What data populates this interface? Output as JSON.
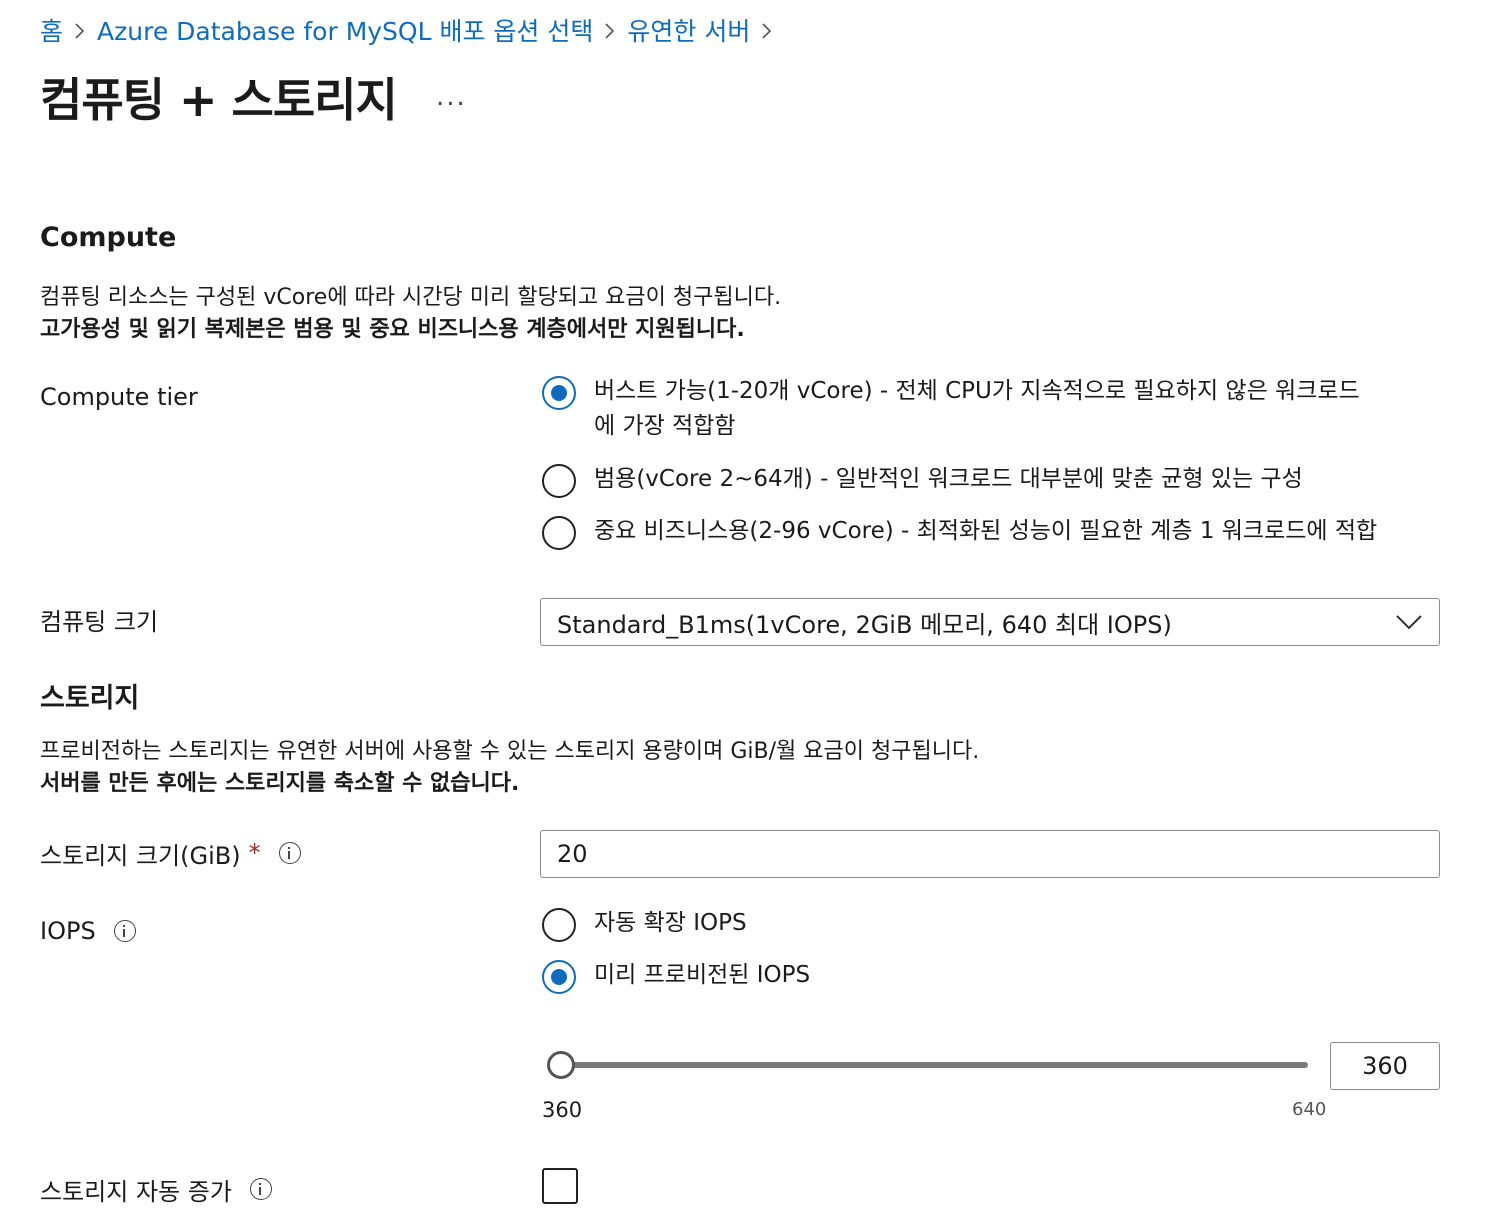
{
  "breadcrumb": {
    "items": [
      "홈",
      "Azure Database for MySQL 배포 옵션 선택",
      "유연한 서버"
    ]
  },
  "page": {
    "title": "컴퓨팅 + 스토리지",
    "more_label": "..."
  },
  "compute": {
    "heading": "Compute",
    "desc_line1": "컴퓨팅 리소스는 구성된 vCore에 따라 시간당 미리 할당되고 요금이 청구됩니다.",
    "desc_line2": "고가용성 및 읽기 복제본은 범용 및 중요 비즈니스용 계층에서만 지원됩니다.",
    "tier_label": "Compute tier",
    "tiers": [
      {
        "line1": "버스트 가능(1-20개 vCore) - 전체 CPU가 지속적으로 필요하지 않은 워크로드",
        "line2": "에 가장 적합함",
        "selected": true
      },
      {
        "line1": "범용(vCore 2~64개) - 일반적인 워크로드 대부분에 맞춘 균형 있는 구성",
        "selected": false
      },
      {
        "line1": "중요 비즈니스용(2-96 vCore) - 최적화된 성능이 필요한 계층 1 워크로드에 적합",
        "selected": false
      }
    ],
    "size_label": "컴퓨팅 크기",
    "size_value": "Standard_B1ms(1vCore, 2GiB 메모리, 640 최대 IOPS)"
  },
  "storage": {
    "heading": "스토리지",
    "desc_line1": "프로비전하는 스토리지는 유연한 서버에 사용할 수 있는 스토리지 용량이며 GiB/월 요금이 청구됩니다.",
    "desc_line2": "서버를 만든 후에는 스토리지를 축소할 수 없습니다.",
    "size_label": "스토리지 크기(GiB)",
    "required_mark": "*",
    "size_value": "20",
    "iops_label": "IOPS",
    "iops_options": [
      {
        "label": "자동 확장 IOPS",
        "selected": false
      },
      {
        "label": "미리 프로비전된 IOPS",
        "selected": true
      }
    ],
    "iops_slider": {
      "min": "360",
      "max": "640",
      "value": "360"
    },
    "autogrow_label": "스토리지 자동 증가",
    "autogrow_checked": false
  },
  "colors": {
    "accent": "#0f6cbd",
    "required": "#a4262c"
  }
}
